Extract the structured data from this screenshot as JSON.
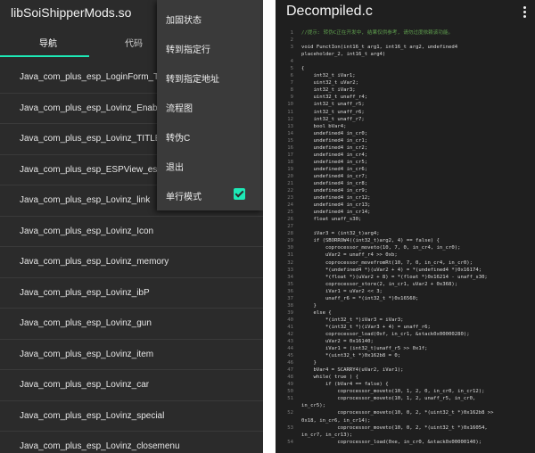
{
  "left": {
    "app_title": "libSoiShipperMods.so",
    "tabs": [
      {
        "label": "导航"
      },
      {
        "label": "代码"
      }
    ],
    "list": [
      "Java_com_plus_esp_LoginForm_Title",
      "Java_com_plus_esp_Lovinz_EnableSou",
      "Java_com_plus_esp_Lovinz_TITLE",
      "Java_com_plus_esp_ESPView_espview",
      "Java_com_plus_esp_Lovinz_link",
      "Java_com_plus_esp_Lovinz_Icon",
      "Java_com_plus_esp_Lovinz_memory",
      "Java_com_plus_esp_Lovinz_ibP",
      "Java_com_plus_esp_Lovinz_gun",
      "Java_com_plus_esp_Lovinz_item",
      "Java_com_plus_esp_Lovinz_car",
      "Java_com_plus_esp_Lovinz_special",
      "Java_com_plus_esp_Lovinz_closemenu"
    ],
    "menu": {
      "items": [
        "加固状态",
        "转到指定行",
        "转到指定地址",
        "流程图",
        "转伪C",
        "退出",
        "单行模式"
      ],
      "single_line_checked": true,
      "check_color": "#1de9b6"
    }
  },
  "right": {
    "file_title": "Decompiled.c",
    "more_icon": "more-vert-icon",
    "code_lines": [
      {
        "n": "1",
        "t": "//提示: 转伪C正在开发中, 结果仅供参考, 请勿过度依赖该功能。",
        "c": true
      },
      {
        "n": "2",
        "t": ""
      },
      {
        "n": "3",
        "t": "void FunctIon(int16_t arg1, int16_t arg2, undefined4"
      },
      {
        "n": "",
        "t": "placeholder_2, int16_t arg4)"
      },
      {
        "n": "4",
        "t": ""
      },
      {
        "n": "5",
        "t": "{"
      },
      {
        "n": "6",
        "t": "    int32_t iVar1;"
      },
      {
        "n": "7",
        "t": "    uint32_t uVar2;"
      },
      {
        "n": "8",
        "t": "    int32_t iVar3;"
      },
      {
        "n": "9",
        "t": "    uint32_t unaff_r4;"
      },
      {
        "n": "10",
        "t": "    int32_t unaff_r5;"
      },
      {
        "n": "11",
        "t": "    int32_t unaff_r6;"
      },
      {
        "n": "12",
        "t": "    int32_t unaff_r7;"
      },
      {
        "n": "13",
        "t": "    bool bVar4;"
      },
      {
        "n": "14",
        "t": "    undefined4 in_cr0;"
      },
      {
        "n": "15",
        "t": "    undefined4 in_cr1;"
      },
      {
        "n": "16",
        "t": "    undefined4 in_cr2;"
      },
      {
        "n": "17",
        "t": "    undefined4 in_cr4;"
      },
      {
        "n": "18",
        "t": "    undefined4 in_cr5;"
      },
      {
        "n": "19",
        "t": "    undefined4 in_cr6;"
      },
      {
        "n": "20",
        "t": "    undefined4 in_cr7;"
      },
      {
        "n": "21",
        "t": "    undefined4 in_cr8;"
      },
      {
        "n": "22",
        "t": "    undefined4 in_cr9;"
      },
      {
        "n": "23",
        "t": "    undefined4 in_cr12;"
      },
      {
        "n": "24",
        "t": "    undefined4 in_cr13;"
      },
      {
        "n": "25",
        "t": "    undefined4 in_cr14;"
      },
      {
        "n": "26",
        "t": "    float unaff_s30;"
      },
      {
        "n": "27",
        "t": ""
      },
      {
        "n": "28",
        "t": "    iVar3 = (int32_t)arg4;"
      },
      {
        "n": "29",
        "t": "    if (SBORROW4((int32_t)arg2, 4) == false) {"
      },
      {
        "n": "30",
        "t": "        coprocessor_moveto(10, 7, 0, in_cr4, in_cr0);"
      },
      {
        "n": "31",
        "t": "        uVar2 = unaff_r4 >> 0xb;"
      },
      {
        "n": "32",
        "t": "        coprocessor_movefromRt(10, 7, 0, in_cr4, in_cr0);"
      },
      {
        "n": "33",
        "t": "        *(undefined4 *)(uVar2 + 4) = *(undefined4 *)0x16174;"
      },
      {
        "n": "34",
        "t": "        *(float *)(uVar2 + 8) = *(float *)0x16214 - unaff_s30;"
      },
      {
        "n": "35",
        "t": "        coprocessor_store(2, in_cr1, uVar2 + 0x368);"
      },
      {
        "n": "36",
        "t": "        iVar1 = uVar2 << 3;"
      },
      {
        "n": "37",
        "t": "        unaff_r6 = *(int32_t *)0x16560;"
      },
      {
        "n": "38",
        "t": "    }"
      },
      {
        "n": "39",
        "t": "    else {"
      },
      {
        "n": "40",
        "t": "        *(int32_t *)iVar3 = iVar3;"
      },
      {
        "n": "41",
        "t": "        *(int32_t *)(iVar3 + 4) = unaff_r6;"
      },
      {
        "n": "42",
        "t": "        coprocessor_load(0xf, in_cr1, &stack0x00000280);"
      },
      {
        "n": "43",
        "t": "        uVar2 = 0x16140;"
      },
      {
        "n": "44",
        "t": "        iVar1 = (int32_t)unaff_r5 >> 0x1f;"
      },
      {
        "n": "45",
        "t": "        *(uint32_t *)0x162b8 = 0;"
      },
      {
        "n": "46",
        "t": "    }"
      },
      {
        "n": "47",
        "t": "    bVar4 = SCARRY4(uVar2, iVar1);"
      },
      {
        "n": "48",
        "t": "    while( true ) {"
      },
      {
        "n": "49",
        "t": "        if (bVar4 == false) {"
      },
      {
        "n": "50",
        "t": "            coprocessor_moveto(10, 1, 2, 0, in_cr0, in_cr12);"
      },
      {
        "n": "51",
        "t": "            coprocessor_moveto(10, 1, 2, unaff_r5, in_cr0,"
      },
      {
        "n": "",
        "t": "in_cr5);"
      },
      {
        "n": "52",
        "t": "            coprocessor_moveto(10, 0, 2, *(uint32_t *)0x162b8 >>"
      },
      {
        "n": "",
        "t": "0x18, in_cr6, in_cr14);"
      },
      {
        "n": "53",
        "t": "            coprocessor_moveto(10, 0, 2, *(uint32_t *)0x16054,"
      },
      {
        "n": "",
        "t": "in_cr7, in_cr13);"
      },
      {
        "n": "54",
        "t": "            coprocessor_load(0xe, in_cr0, &stack0x00000140);"
      }
    ]
  }
}
